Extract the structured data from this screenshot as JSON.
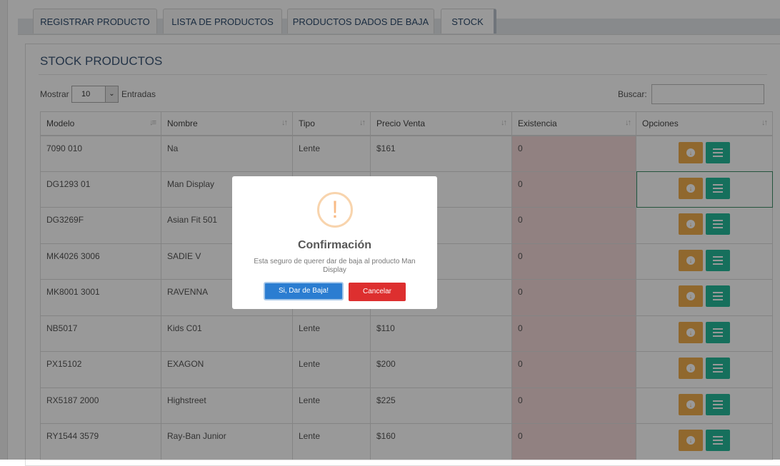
{
  "tabs": [
    {
      "label": "REGISTRAR PRODUCTO"
    },
    {
      "label": "LISTA DE PRODUCTOS"
    },
    {
      "label": "PRODUCTOS DADOS DE BAJA"
    },
    {
      "label": "STOCK"
    }
  ],
  "active_tab": "STOCK",
  "panel": {
    "title": "STOCK PRODUCTOS",
    "show_label": "Mostrar",
    "show_value": "10",
    "entries_label": "Entradas",
    "search_label": "Buscar:",
    "search_value": ""
  },
  "table": {
    "headers": [
      "Modelo",
      "Nombre",
      "Tipo",
      "Precio Venta",
      "Existencia",
      "Opciones"
    ],
    "rows": [
      {
        "modelo": "7090 010",
        "nombre": "Na",
        "tipo": "Lente",
        "precio": "$161",
        "existencia": "0"
      },
      {
        "modelo": "DG1293 01",
        "nombre": "Man Display",
        "tipo": "",
        "precio": "",
        "existencia": "0"
      },
      {
        "modelo": "DG3269F",
        "nombre": "Asian Fit 501",
        "tipo": "",
        "precio": "",
        "existencia": "0"
      },
      {
        "modelo": "MK4026 3006",
        "nombre": "SADIE V",
        "tipo": "",
        "precio": "",
        "existencia": "0"
      },
      {
        "modelo": "MK8001 3001",
        "nombre": "RAVENNA",
        "tipo": "",
        "precio": "",
        "existencia": "0"
      },
      {
        "modelo": "NB5017",
        "nombre": "Kids C01",
        "tipo": "Lente",
        "precio": "$110",
        "existencia": "0"
      },
      {
        "modelo": "PX15102",
        "nombre": "EXAGON",
        "tipo": "Lente",
        "precio": "$200",
        "existencia": "0"
      },
      {
        "modelo": "RX5187 2000",
        "nombre": "Highstreet",
        "tipo": "Lente",
        "precio": "$225",
        "existencia": "0"
      },
      {
        "modelo": "RY1544 3579",
        "nombre": "Ray-Ban Junior",
        "tipo": "Lente",
        "precio": "$160",
        "existencia": "0"
      }
    ]
  },
  "modal": {
    "icon": "!",
    "title": "Confirmación",
    "text": "Esta seguro de querer dar de baja al producto Man Display",
    "confirm_label": "Si, Dar de Baja!",
    "cancel_label": "Cancelar"
  },
  "colors": {
    "download_button": "#f0ad4e",
    "list_button": "#26b99a",
    "existencia_bg": "#f2d8d8",
    "confirm_button": "#2b7dd1",
    "cancel_button": "#dd2f2f"
  }
}
